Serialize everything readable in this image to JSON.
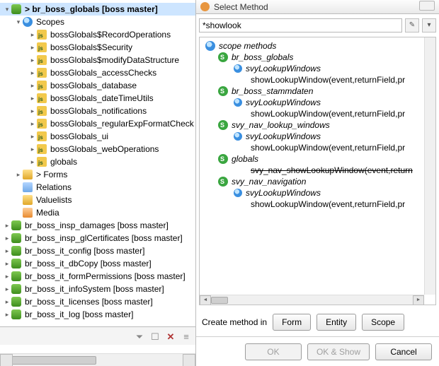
{
  "left": {
    "root_expanded": {
      "label": "> br_boss_globals [boss master]"
    },
    "scopes_label": "Scopes",
    "scopes": [
      "bossGlobals$RecordOperations",
      "bossGlobals$Security",
      "bossGlobals$modifyDataStructure",
      "bossGlobals_accessChecks",
      "bossGlobals_database",
      "bossGlobals_dateTimeUtils",
      "bossGlobals_notifications",
      "bossGlobals_regularExpFormatCheck",
      "bossGlobals_ui",
      "bossGlobals_webOperations",
      "globals"
    ],
    "forms": "> Forms",
    "relations": "Relations",
    "valuelists": "Valuelists",
    "media": "Media",
    "modules": [
      "br_boss_insp_damages [boss master]",
      "br_boss_insp_glCertificates [boss master]",
      "br_boss_it_config [boss master]",
      "br_boss_it_dbCopy [boss master]",
      "br_boss_it_formPermissions [boss master]",
      "br_boss_it_infoSystem [boss master]",
      "br_boss_it_licenses [boss master]",
      "br_boss_it_log [boss master]"
    ]
  },
  "dialog": {
    "title": "Select Method",
    "search_value": "*showlook",
    "root": "scope methods",
    "groups": [
      {
        "name": "br_boss_globals",
        "child": "svyLookupWindows",
        "method": "showLookupWindow(event,returnField,pr"
      },
      {
        "name": "br_boss_stammdaten",
        "child": "svyLookupWindows",
        "method": "showLookupWindow(event,returnField,pr"
      },
      {
        "name": "svy_nav_lookup_windows",
        "child": "svyLookupWindows",
        "method": "showLookupWindow(event,returnField,pr"
      },
      {
        "name": "globals",
        "child_strike": "svy_nav_showLookupWindow(event,return"
      },
      {
        "name": "svy_nav_navigation",
        "child": "svyLookupWindows",
        "method": "showLookupWindow(event,returnField,pr"
      }
    ],
    "create_label": "Create method in",
    "btn_form": "Form",
    "btn_entity": "Entity",
    "btn_scope": "Scope",
    "btn_ok": "OK",
    "btn_ok_show": "OK & Show",
    "btn_cancel": "Cancel"
  }
}
